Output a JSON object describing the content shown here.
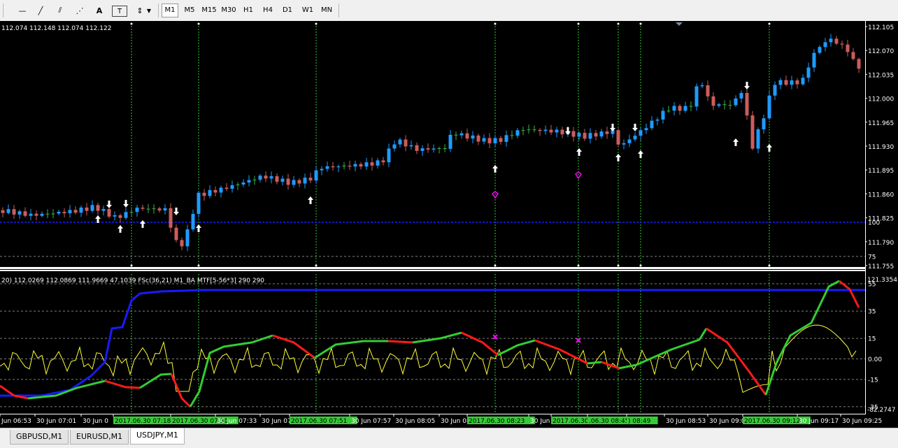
{
  "toolbar": {
    "tools": [
      {
        "name": "horizontal-line-tool-icon",
        "glyph": "—"
      },
      {
        "name": "trendline-tool-icon",
        "glyph": "╱"
      },
      {
        "name": "fibonacci-tool-icon",
        "glyph": "⫽"
      },
      {
        "name": "fibonacci-fan-tool-icon",
        "glyph": "⋰"
      },
      {
        "name": "text-tool-icon",
        "glyph": "A"
      },
      {
        "name": "text-label-tool-icon",
        "glyph": "T"
      },
      {
        "name": "arrows-tool-icon",
        "glyph": "⇕"
      }
    ],
    "timeframes": [
      "M1",
      "M5",
      "M15",
      "M30",
      "H1",
      "H4",
      "D1",
      "W1",
      "MN"
    ],
    "active_timeframe": "M1"
  },
  "main_chart": {
    "ohlc_text": "112.074 112.148 112.074 112.122",
    "price_labels": [
      "112.105",
      "112.070",
      "112.035",
      "112.000",
      "111.965",
      "111.930",
      "111.895",
      "111.860",
      "111.825",
      "111.790",
      "111.755"
    ],
    "colors": {
      "bull": "#1e9bff",
      "bear": "#cd5c5c",
      "doji": "#3cb043",
      "grid": "#2bd12b",
      "arrow": "#ffffff",
      "marker": "#ff00ff"
    }
  },
  "indicator": {
    "header_text": "20) 112.0269 112.0869 111.9669 47.1039   FSc(36,21)   M1_BA MTF[5-56*3] 290 290",
    "top_value": "121.3354",
    "bottom_value": "-82.2747",
    "levels": [
      "100",
      "75",
      "55",
      "35",
      "15",
      "0.00",
      "-15",
      "-35",
      "-55",
      "-75"
    ],
    "colors": {
      "blue": "#1a1aff",
      "green": "#32cd32",
      "red": "#ff1a1a",
      "yellow": "#ffff33",
      "level": "#808080",
      "cross": "#ff00ff"
    }
  },
  "time_axis": [
    {
      "label": "Jun 06:53",
      "hl": false
    },
    {
      "label": "30 Jun 07:01",
      "hl": false
    },
    {
      "label": "30 Jun 0",
      "hl": false
    },
    {
      "label": "2017.06.30 07:18",
      "hl": true
    },
    {
      "label": "2017.06.30 07:30",
      "hl": true
    },
    {
      "label": "30 Jun 07:33",
      "hl": false
    },
    {
      "label": "30 Jun 07",
      "hl": false
    },
    {
      "label": "2017.06.30 07:51",
      "hl": true
    },
    {
      "label": "30 Jun 07:57",
      "hl": false
    },
    {
      "label": "30 Jun 08:05",
      "hl": false
    },
    {
      "label": "30 Jun 08",
      "hl": false
    },
    {
      "label": "2017.06.30 08:23",
      "hl": true
    },
    {
      "label": "30 Jun 0",
      "hl": false
    },
    {
      "label": "2017.06.30 08:38",
      "hl": true
    },
    {
      "label": ".06.30 08:45",
      "hl": true
    },
    {
      "label": ") 08:49",
      "hl": true
    },
    {
      "label": "30 Jun 08:53",
      "hl": false
    },
    {
      "label": "30 Jun 09:0",
      "hl": false
    },
    {
      "label": "2017.06.30 09:12",
      "hl": true
    },
    {
      "label": "30 Jun 09:17",
      "hl": false
    },
    {
      "label": "30 Jun 09:25",
      "hl": false
    }
  ],
  "symbol_tabs": [
    "GBPUSD,M1",
    "EURUSD,M1",
    "USDJPY,M1"
  ],
  "active_tab": "USDJPY,M1"
}
